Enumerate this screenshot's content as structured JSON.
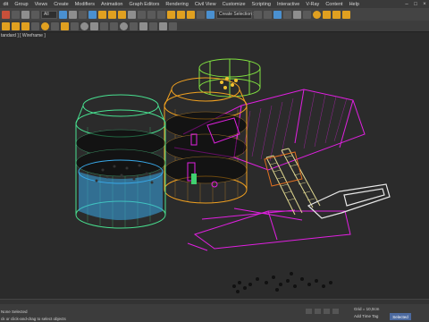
{
  "menu": {
    "items": [
      "dit",
      "Group",
      "Views",
      "Create",
      "Modifiers",
      "Animation",
      "Graph Editors",
      "Rendering",
      "Civil View",
      "Customize",
      "Scripting",
      "Interactive",
      "V-Ray",
      "Content",
      "Help"
    ]
  },
  "toolbar": {
    "view_dropdown": "All",
    "selection_set_dropdown": "Create Selection Se"
  },
  "viewport": {
    "label": "tandard ] [ Wireframe ]"
  },
  "status": {
    "selection": "None Selected",
    "prompt": "ck or click-and-drag to select objects",
    "grid": "Grid = 10,0cm",
    "add_time_tag": "Add Time Tag",
    "selected_button": "Selected"
  },
  "colors": {
    "jar_green": "#48e090",
    "jar_cyan": "#38a8e8",
    "jar_orange": "#f0a020",
    "lid_green": "#80e040",
    "tool_magenta": "#e020e0",
    "spring_tan": "#e0d890",
    "blade_white": "#e8e8e8",
    "frame_orange": "#e07020",
    "viewport_bg": "#2b2b2b"
  }
}
